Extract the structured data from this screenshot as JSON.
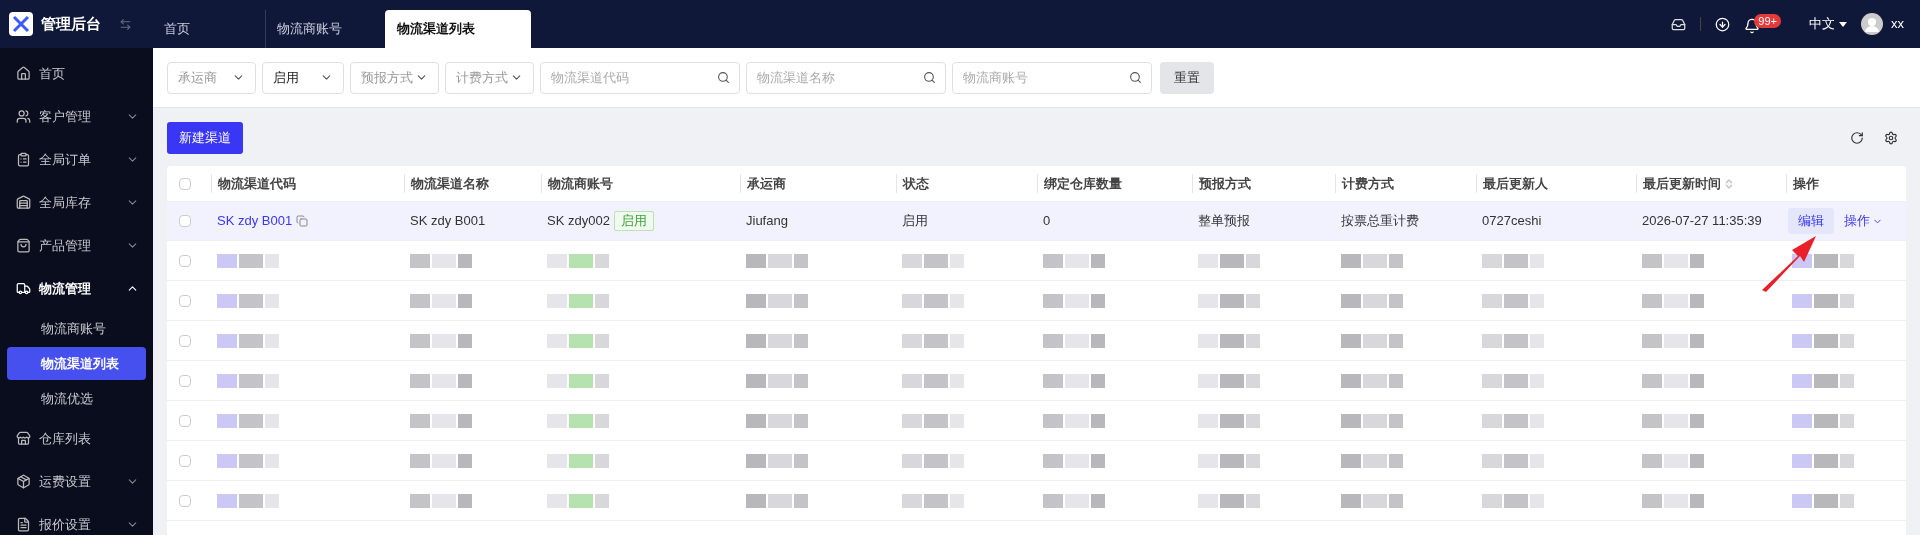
{
  "app": {
    "title": "管理后台"
  },
  "tabs": [
    {
      "label": "首页",
      "selected": false
    },
    {
      "label": "物流商账号",
      "selected": false
    },
    {
      "label": "物流渠道列表",
      "selected": true
    }
  ],
  "header": {
    "notifications": "99+",
    "language": "中文",
    "user": "xx"
  },
  "sidebar": {
    "items": [
      {
        "label": "首页",
        "kind": "home",
        "expandable": false,
        "expanded": false
      },
      {
        "label": "客户管理",
        "kind": "users",
        "expandable": true,
        "expanded": false
      },
      {
        "label": "全局订单",
        "kind": "orders",
        "expandable": true,
        "expanded": false
      },
      {
        "label": "全局库存",
        "kind": "stock",
        "expandable": true,
        "expanded": false
      },
      {
        "label": "产品管理",
        "kind": "product",
        "expandable": true,
        "expanded": false
      },
      {
        "label": "物流管理",
        "kind": "truck",
        "expandable": true,
        "expanded": true,
        "children": [
          {
            "label": "物流商账号",
            "selected": false
          },
          {
            "label": "物流渠道列表",
            "selected": true
          },
          {
            "label": "物流优选",
            "selected": false
          }
        ]
      },
      {
        "label": "仓库列表",
        "kind": "warehouse",
        "expandable": false,
        "expanded": false
      },
      {
        "label": "运费设置",
        "kind": "box",
        "expandable": true,
        "expanded": false
      },
      {
        "label": "报价设置",
        "kind": "doc",
        "expandable": true,
        "expanded": false
      }
    ]
  },
  "filters": [
    {
      "kind": "select",
      "placeholder": "承运商"
    },
    {
      "kind": "select",
      "value": "启用"
    },
    {
      "kind": "select",
      "placeholder": "预报方式"
    },
    {
      "kind": "select",
      "placeholder": "计费方式"
    },
    {
      "kind": "search",
      "placeholder": "物流渠道代码"
    },
    {
      "kind": "search",
      "placeholder": "物流渠道名称"
    },
    {
      "kind": "search",
      "placeholder": "物流商账号"
    }
  ],
  "reset_button": "重置",
  "new_button": "新建渠道",
  "table": {
    "columns": [
      "物流渠道代码",
      "物流渠道名称",
      "物流商账号",
      "承运商",
      "状态",
      "绑定仓库数量",
      "预报方式",
      "计费方式",
      "最后更新人",
      "最后更新时间",
      "操作"
    ],
    "select_all": {
      "checked": false
    },
    "rows": [
      {
        "selected": false,
        "checked": false,
        "code": "SK zdy B001",
        "name": "SK zdy B001",
        "account": "SK zdy002",
        "account_status": "启用",
        "carrier": "Jiufang",
        "status": "启用",
        "warehouses": "0",
        "forecast": "整单预报",
        "billing": "按票总重计费",
        "updater": "0727ceshi",
        "updated": "2026-07-27 11:35:39",
        "edit": "编辑",
        "more": "操作"
      }
    ]
  },
  "pixelated_rows": [
    {
      "checked": false
    },
    {
      "checked": false
    },
    {
      "checked": false
    },
    {
      "checked": false
    },
    {
      "checked": false
    },
    {
      "checked": false
    },
    {
      "checked": false
    }
  ]
}
